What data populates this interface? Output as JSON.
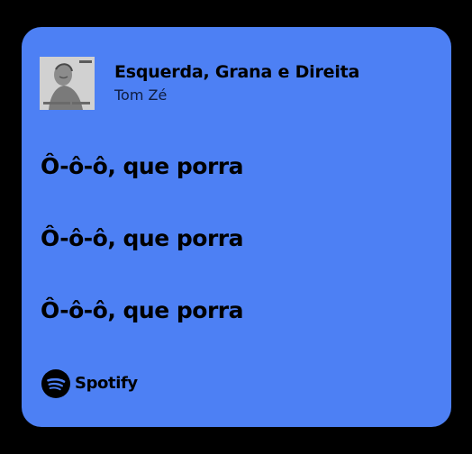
{
  "card": {
    "background_color": "#4d80f4",
    "track": {
      "title": "Esquerda, Grana e Direita",
      "artist": "Tom Zé",
      "cover_icon": "album-cover-tom-ze"
    },
    "lyrics": [
      "Ô-ô-ô, que porra",
      "Ô-ô-ô, que porra",
      "Ô-ô-ô, que porra"
    ],
    "brand": {
      "name": "Spotify",
      "icon": "spotify-icon"
    }
  }
}
